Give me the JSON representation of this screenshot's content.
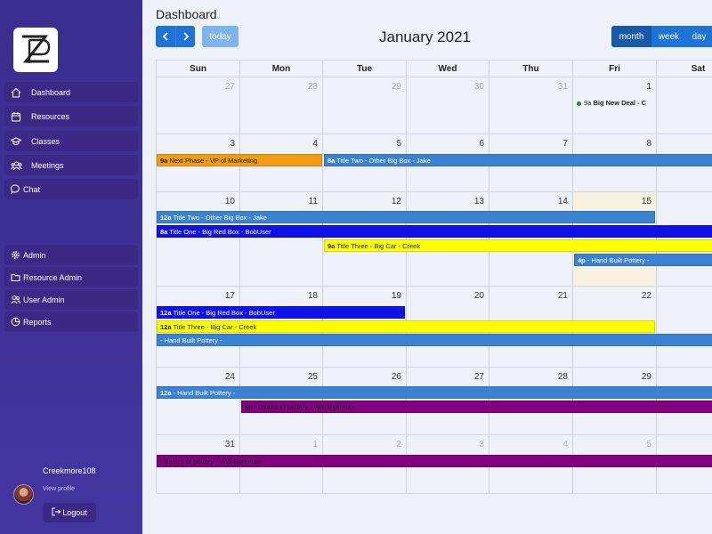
{
  "page": {
    "title": "Dashboard"
  },
  "sidebar": {
    "items": [
      {
        "label": "Dashboard",
        "icon": "home-icon"
      },
      {
        "label": "Resources",
        "icon": "calendar-icon"
      },
      {
        "label": "Classes",
        "icon": "graduation-cap-icon"
      },
      {
        "label": "Meetings",
        "icon": "people-icon"
      },
      {
        "label": "Chat",
        "icon": "chat-icon"
      }
    ],
    "admin_items": [
      {
        "label": "Admin",
        "icon": "gear-icon"
      },
      {
        "label": "Resource Admin",
        "icon": "folder-icon"
      },
      {
        "label": "User Admin",
        "icon": "users-icon"
      },
      {
        "label": "Reports",
        "icon": "pie-chart-icon"
      }
    ],
    "user": {
      "name": "Creekmore108",
      "view_profile": "View profile",
      "logout": "Logout"
    }
  },
  "toolbar": {
    "today": "today",
    "title": "January 2021",
    "views": [
      "month",
      "week",
      "day"
    ],
    "active_view": "month"
  },
  "calendar": {
    "days_of_week": [
      "Sun",
      "Mon",
      "Tue",
      "Wed",
      "Thu",
      "Fri",
      "Sat"
    ],
    "weeks": [
      [
        "27",
        "28",
        "29",
        "30",
        "31",
        "1",
        ""
      ],
      [
        "3",
        "4",
        "5",
        "6",
        "7",
        "8",
        ""
      ],
      [
        "10",
        "11",
        "12",
        "13",
        "14",
        "15",
        ""
      ],
      [
        "17",
        "18",
        "19",
        "20",
        "21",
        "22",
        ""
      ],
      [
        "24",
        "25",
        "26",
        "27",
        "28",
        "29",
        ""
      ],
      [
        "31",
        "1",
        "2",
        "3",
        "4",
        "5",
        ""
      ]
    ],
    "today": "15",
    "events": {
      "w1_dot": {
        "time": "9a",
        "title": "Big New Deal - C"
      },
      "w2_a": {
        "time": "9a",
        "title": "Next Phase - VP of Marketing"
      },
      "w2_b": {
        "time": "8a",
        "title": "Title Two - Other Big Box - Jake"
      },
      "w3_a": {
        "time": "12a",
        "title": "Title Two - Other Big Box - Jake"
      },
      "w3_b": {
        "time": "8a",
        "title": "Title One - Big Red Box - BobUser"
      },
      "w3_c": {
        "time": "9a",
        "title": "Title Three - Big Car - Creek"
      },
      "w3_d": {
        "time": "4p",
        "title": "- Hand Built Pottery -"
      },
      "w4_a": {
        "time": "12a",
        "title": "Title One - Big Red Box - BobUser"
      },
      "w4_b": {
        "time": "12a",
        "title": "Title Three - Big Car - Creek"
      },
      "w4_c": {
        "time": "",
        "title": "- Hand Built Pottery -"
      },
      "w5_a": {
        "time": "12a",
        "title": "- Hand Built Pottery -"
      },
      "w5_b": {
        "time": "6p",
        "title": "- Basics of pottery - Willi Egerman"
      },
      "w6_a": {
        "time": "",
        "title": "- Basics of pottery - Willi Egerman"
      }
    }
  }
}
